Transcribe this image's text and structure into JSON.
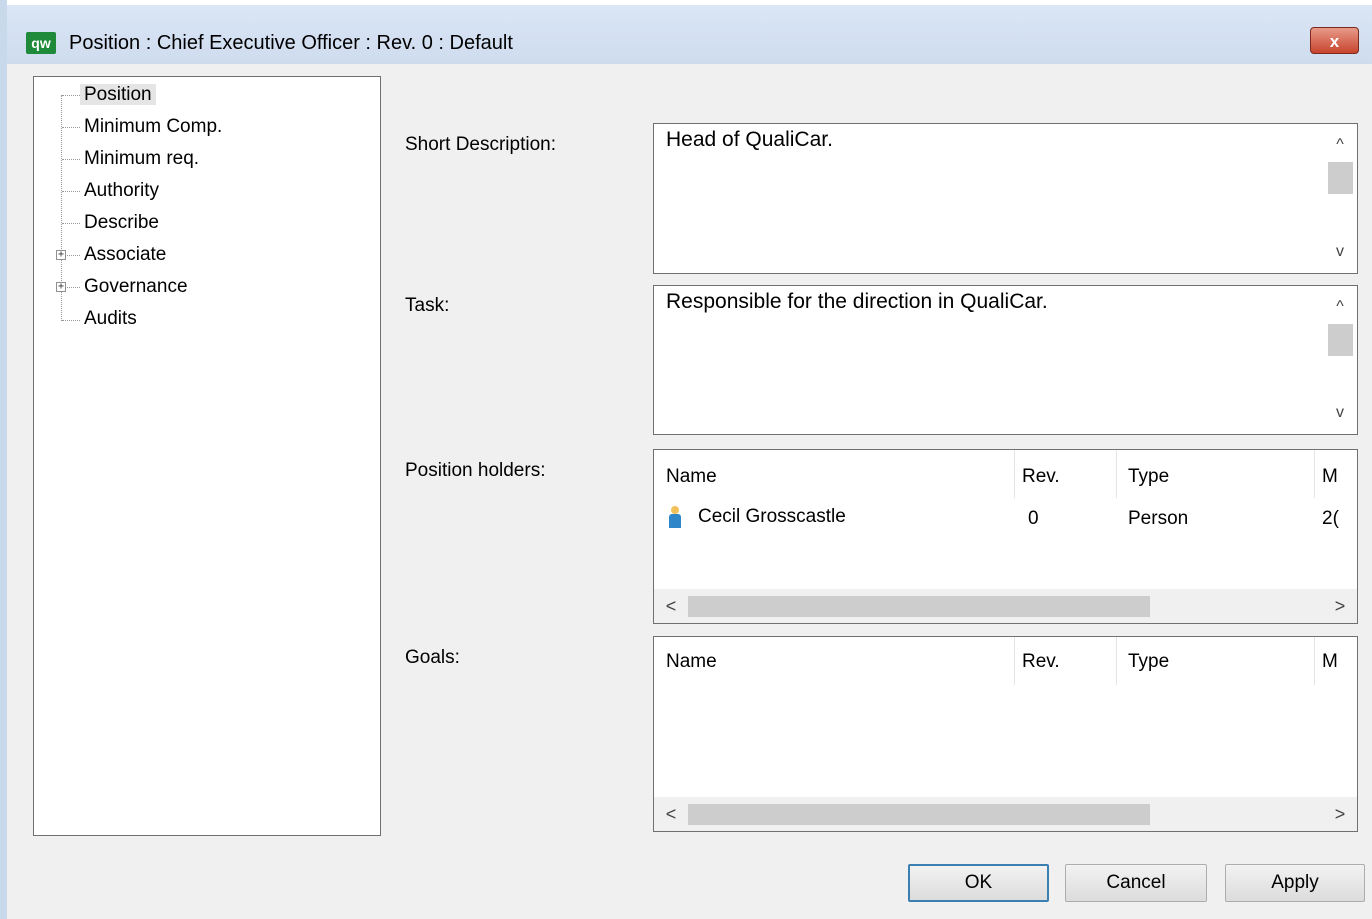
{
  "window": {
    "app_icon_text": "qw",
    "title": "Position : Chief Executive Officer : Rev. 0  : Default",
    "close_label": "x"
  },
  "tree": {
    "items": [
      {
        "label": "Position",
        "selected": true,
        "expandable": false
      },
      {
        "label": "Minimum Comp.",
        "expandable": false
      },
      {
        "label": "Minimum req.",
        "expandable": false
      },
      {
        "label": "Authority",
        "expandable": false
      },
      {
        "label": "Describe",
        "expandable": false
      },
      {
        "label": "Associate",
        "expandable": true
      },
      {
        "label": "Governance",
        "expandable": true
      },
      {
        "label": "Audits",
        "expandable": false
      }
    ]
  },
  "form": {
    "short_description": {
      "label": "Short Description:",
      "value": "Head of QualiCar."
    },
    "task": {
      "label": "Task:",
      "value": "Responsible for the direction in QualiCar."
    },
    "position_holders": {
      "label": "Position holders:",
      "columns": [
        "Name",
        "Rev.",
        "Type",
        "M"
      ],
      "rows": [
        {
          "name": "Cecil Grosscastle",
          "rev": "0",
          "type": "Person",
          "m": "2("
        }
      ]
    },
    "goals": {
      "label": "Goals:",
      "columns": [
        "Name",
        "Rev.",
        "Type",
        "M"
      ],
      "rows": []
    }
  },
  "buttons": {
    "ok": "OK",
    "cancel": "Cancel",
    "apply": "Apply"
  },
  "icons": {
    "scroll_up": "^",
    "scroll_down": "v",
    "scroll_left": "<",
    "scroll_right": ">",
    "expand": "+"
  },
  "colors": {
    "app_icon_bg": "#1f8a3a",
    "close_button": "#c7442d",
    "default_button_border": "#3c7fb1"
  }
}
